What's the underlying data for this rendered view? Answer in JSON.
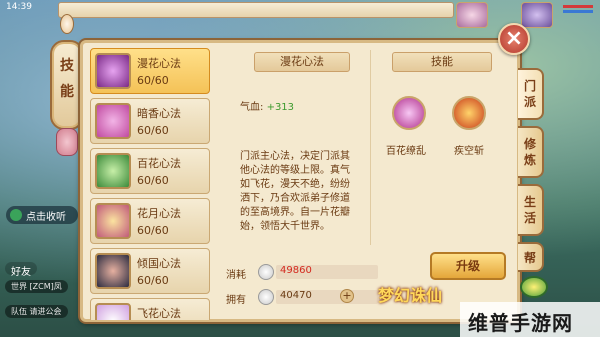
{
  "status": {
    "time": "14:39"
  },
  "hud": {
    "chat_button": "点击收听",
    "friends": "好友",
    "channel_1": "世界 [ZCM]凤",
    "channel_2": "队伍 请进公会"
  },
  "tab_left": {
    "label_1": "技",
    "label_2": "能"
  },
  "skills": [
    {
      "name": "漫花心法",
      "level": "60/60",
      "color": "#7a2a86"
    },
    {
      "name": "暗香心法",
      "level": "60/60",
      "color": "#c04aa0"
    },
    {
      "name": "百花心法",
      "level": "60/60",
      "color": "#3c8a3a"
    },
    {
      "name": "花月心法",
      "level": "60/60",
      "color": "#c05a7a"
    },
    {
      "name": "倾国心法",
      "level": "60/60",
      "color": "#2c2c40"
    },
    {
      "name": "飞花心法",
      "level": "",
      "color": "#d0a0e0"
    }
  ],
  "detail": {
    "title": "漫花心法",
    "qixue_label": "气血:",
    "qixue_value": "+313",
    "description": "门派主心法，决定门派其他心法的等级上限。真气如飞花，漫天不绝，纷纷洒下，乃合欢派弟子修道的至高境界。自一片花瓣始，领悟大千世界。",
    "cost_label": "消耗",
    "cost_value": "49860",
    "have_label": "拥有",
    "have_value": "40470"
  },
  "skills_panel": {
    "title": "技能",
    "items": [
      {
        "name": "百花缭乱",
        "color": "#b0308c"
      },
      {
        "name": "疾空斩",
        "color": "#c83a1a"
      }
    ],
    "upgrade_label": "升级"
  },
  "right_tabs": [
    {
      "c1": "门",
      "c2": "派"
    },
    {
      "c1": "修",
      "c2": "炼"
    },
    {
      "c1": "生",
      "c2": "活"
    },
    {
      "c1": "帮",
      "c2": ""
    }
  ],
  "overlay": {
    "logo_text": "梦幻诛仙",
    "watermark": "维普手游网"
  }
}
